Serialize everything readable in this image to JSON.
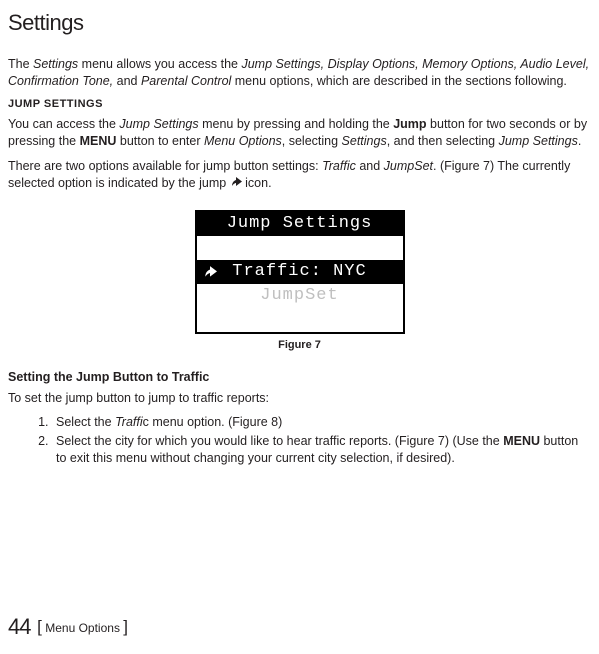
{
  "title": "Settings",
  "intro_1a": "The ",
  "intro_1b": "Settings",
  "intro_1c": " menu allows you access the ",
  "intro_1d": "Jump Settings, Display Options, Memory Options, Audio Level, Confirmation Tone,",
  "intro_1e": " and ",
  "intro_1f": "Parental Control",
  "intro_1g": " menu options, which are described in the sections following.",
  "jump_head": "JUMP SETTINGS",
  "jp1_a": "You can access the ",
  "jp1_b": "Jump Settings",
  "jp1_c": " menu by pressing and holding the ",
  "jp1_d": "Jump",
  "jp1_e": " button for two seconds or by pressing the ",
  "jp1_f": "MENU",
  "jp1_g": " button to enter ",
  "jp1_h": "Menu Options",
  "jp1_i": ", selecting ",
  "jp1_j": "Settings",
  "jp1_k": ", and then selecting ",
  "jp1_l": "Jump Settings",
  "jp1_m": ".",
  "jp2_a": "There are two options available for jump button settings: ",
  "jp2_b": "Traffic",
  "jp2_c": " and ",
  "jp2_d": "JumpSet",
  "jp2_e": ". (Figure 7) The currently selected option is indicated by the jump ",
  "jp2_f": " icon.",
  "lcd": {
    "title": "Jump Settings",
    "row_sel": "Traffic: NYC",
    "row_dim": "JumpSet"
  },
  "fig_caption": "Figure 7",
  "h3": "Setting the Jump Button to Traffic",
  "set_intro": "To set the jump button to jump to traffic reports:",
  "li1_a": "Select the ",
  "li1_b": "Traffi",
  "li1_c": "c menu option. (Figure 8)",
  "li2_a": "Select the city for which you would like to hear traffic reports. (Figure 7) (Use the ",
  "li2_b": "MENU",
  "li2_c": " button to exit this menu without changing your current city selection, if desired).",
  "page_number": "44",
  "footer_section": "Menu Options"
}
